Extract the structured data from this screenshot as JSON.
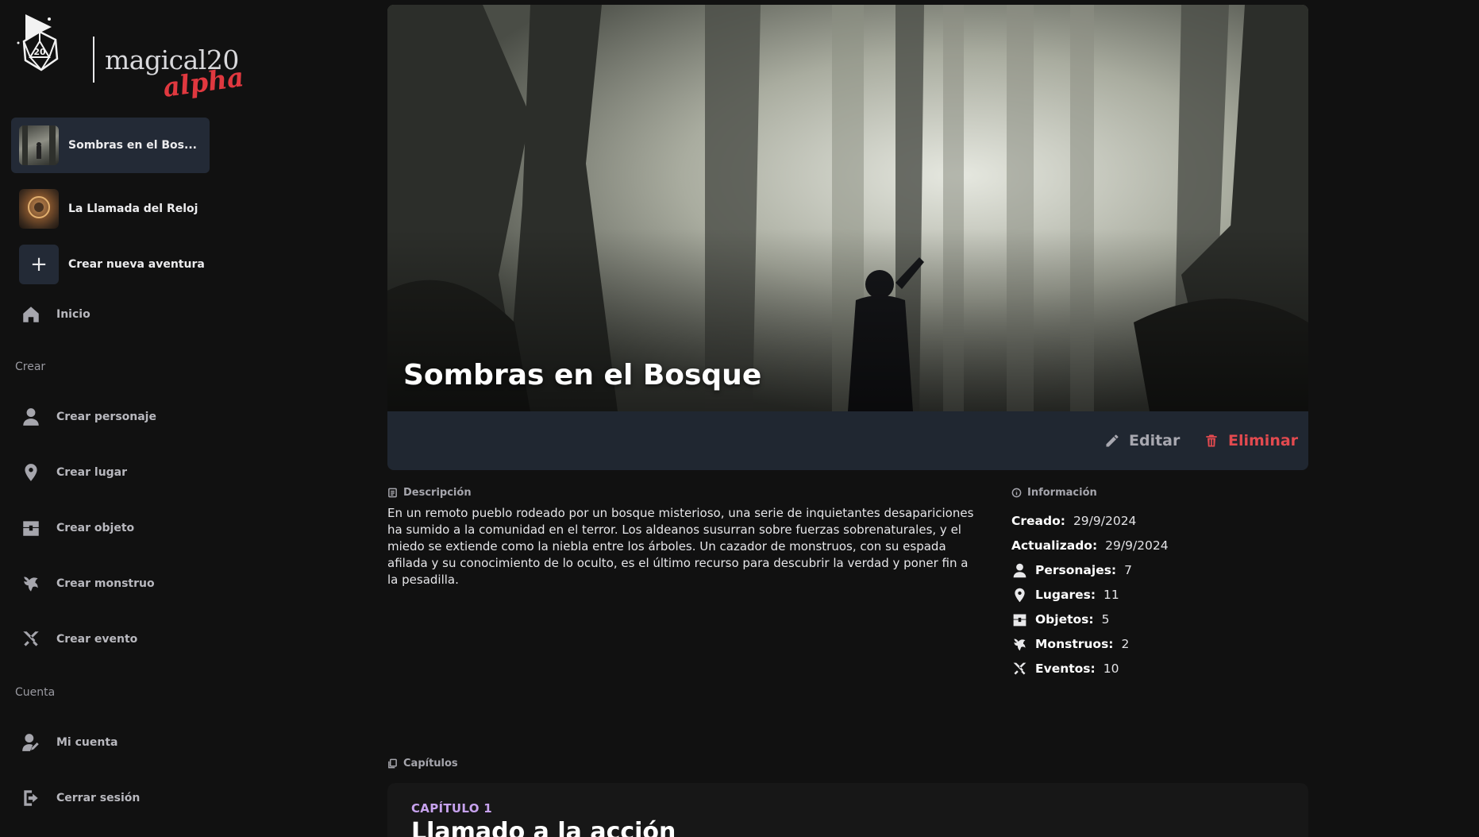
{
  "brand": {
    "name": "magical20",
    "tag": "alpha",
    "die_label": "20"
  },
  "adventures": [
    {
      "label": "Sombras en el Bos...",
      "active": true
    },
    {
      "label": "La Llamada del Reloj",
      "active": false
    }
  ],
  "create_adventure_label": "Crear nueva aventura",
  "nav": {
    "home": "Inicio",
    "create_section": "Crear",
    "create_items": [
      {
        "label": "Crear personaje",
        "icon": "person-icon"
      },
      {
        "label": "Crear lugar",
        "icon": "location-pin-icon"
      },
      {
        "label": "Crear objeto",
        "icon": "chest-icon"
      },
      {
        "label": "Crear monstruo",
        "icon": "dragon-icon"
      },
      {
        "label": "Crear evento",
        "icon": "crossed-swords-icon"
      }
    ],
    "account_section": "Cuenta",
    "account_items": [
      {
        "label": "Mi cuenta",
        "icon": "user-settings-icon"
      },
      {
        "label": "Cerrar sesión",
        "icon": "logout-icon"
      }
    ]
  },
  "adventure": {
    "title": "Sombras en el Bosque",
    "edit_label": "Editar",
    "delete_label": "Eliminar",
    "description_heading": "Descripción",
    "description": "En un remoto pueblo rodeado por un bosque misterioso, una serie de inquietantes desapariciones ha sumido a la comunidad en el terror. Los aldeanos susurran sobre fuerzas sobrenaturales, y el miedo se extiende como la niebla entre los árboles. Un cazador de monstruos, con su espada afilada y su conocimiento de lo oculto, es el último recurso para descubrir la verdad y poner fin a la pesadilla.",
    "info_heading": "Información",
    "info": [
      {
        "key": "Creado:",
        "value": "29/9/2024"
      },
      {
        "key": "Actualizado:",
        "value": "29/9/2024"
      },
      {
        "key": "Personajes:",
        "value": "7",
        "icon": "person-icon"
      },
      {
        "key": "Lugares:",
        "value": "11",
        "icon": "location-pin-icon"
      },
      {
        "key": "Objetos:",
        "value": "5",
        "icon": "chest-icon"
      },
      {
        "key": "Monstruos:",
        "value": "2",
        "icon": "dragon-icon"
      },
      {
        "key": "Eventos:",
        "value": "10",
        "icon": "crossed-swords-icon"
      }
    ],
    "chapters_heading": "Capítulos",
    "chapters": [
      {
        "number": "CAPÍTULO 1",
        "title": "Llamado a la acción"
      }
    ]
  },
  "colors": {
    "background": "#111111",
    "sidebar_active": "#232a36",
    "action_bar": "#202731",
    "danger": "#e34a4f",
    "chapter_accent": "#c7a2ee",
    "brand_accent": "#e0383f"
  }
}
